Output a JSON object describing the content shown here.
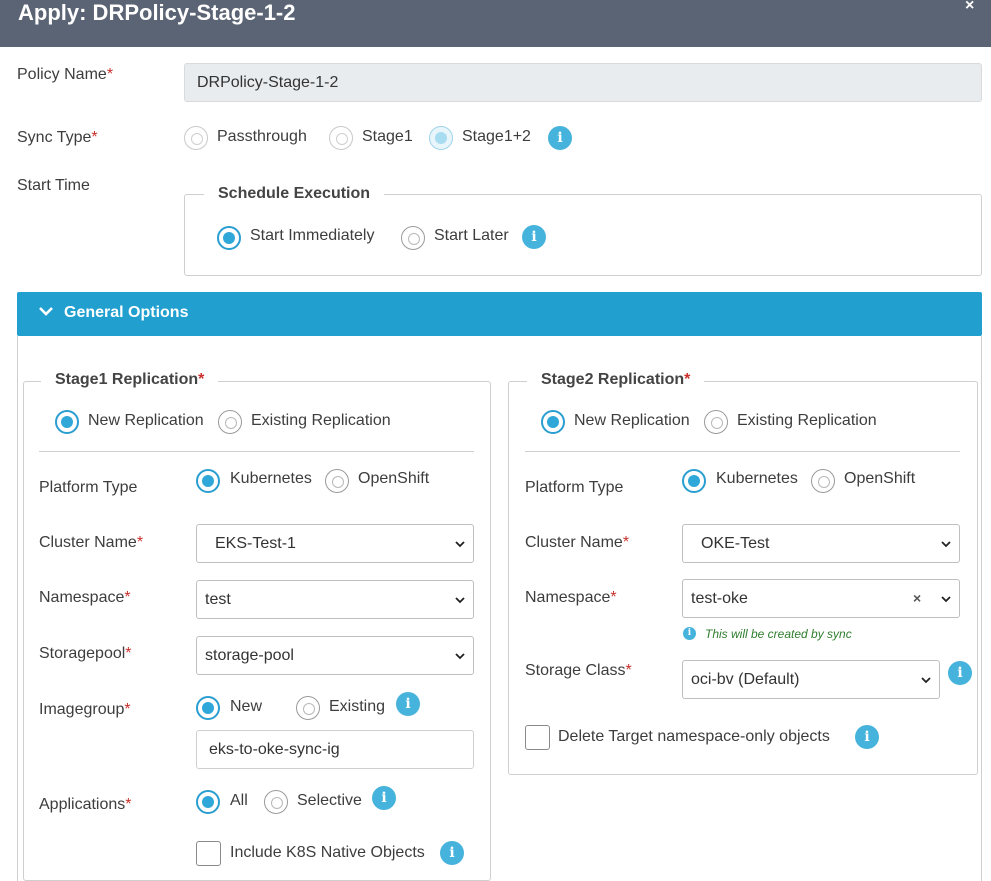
{
  "dialog": {
    "title": "Apply: DRPolicy-Stage-1-2",
    "close_glyph": "×"
  },
  "form": {
    "policy_name": {
      "label": "Policy Name",
      "value": "DRPolicy-Stage-1-2"
    },
    "sync_type": {
      "label": "Sync Type",
      "options": [
        "Passthrough",
        "Stage1",
        "Stage1+2"
      ],
      "selected": "Stage1+2"
    },
    "start_time": {
      "label": "Start Time",
      "legend": "Schedule Execution",
      "options": [
        "Start Immediately",
        "Start Later"
      ],
      "selected": "Start Immediately"
    }
  },
  "general_options": {
    "label": "General Options"
  },
  "stage1": {
    "legend": "Stage1 Replication",
    "replication_options": [
      "New Replication",
      "Existing Replication"
    ],
    "replication_selected": "New Replication",
    "platform_type": {
      "label": "Platform Type",
      "options": [
        "Kubernetes",
        "OpenShift"
      ],
      "selected": "Kubernetes"
    },
    "cluster_name": {
      "label": "Cluster Name",
      "value": "EKS-Test-1"
    },
    "namespace": {
      "label": "Namespace",
      "value": "test"
    },
    "storagepool": {
      "label": "Storagepool",
      "value": "storage-pool"
    },
    "imagegroup": {
      "label": "Imagegroup",
      "options": [
        "New",
        "Existing"
      ],
      "selected": "New",
      "value": "eks-to-oke-sync-ig"
    },
    "applications": {
      "label": "Applications",
      "options": [
        "All",
        "Selective"
      ],
      "selected": "All"
    },
    "include_native": {
      "label": "Include K8S Native Objects",
      "checked": false
    }
  },
  "stage2": {
    "legend": "Stage2 Replication",
    "replication_options": [
      "New Replication",
      "Existing Replication"
    ],
    "replication_selected": "New Replication",
    "platform_type": {
      "label": "Platform Type",
      "options": [
        "Kubernetes",
        "OpenShift"
      ],
      "selected": "Kubernetes"
    },
    "cluster_name": {
      "label": "Cluster Name",
      "value": "OKE-Test"
    },
    "namespace": {
      "label": "Namespace",
      "value": "test-oke",
      "note": "This will be created by sync",
      "clear_glyph": "×"
    },
    "storage_class": {
      "label": "Storage Class",
      "value": "oci-bv (Default)"
    },
    "delete_target": {
      "label": "Delete Target namespace-only objects",
      "checked": false
    }
  },
  "required_mark": "*",
  "icons": {
    "info": "info-icon",
    "chevron": "chevron-down-icon",
    "close": "close-icon",
    "clear": "clear-icon"
  },
  "colors": {
    "header_bg": "#5b6474",
    "banner_bg": "#21a0cf",
    "accent": "#2fa7d8",
    "required": "#c9302c",
    "note": "#2f7d2f"
  }
}
